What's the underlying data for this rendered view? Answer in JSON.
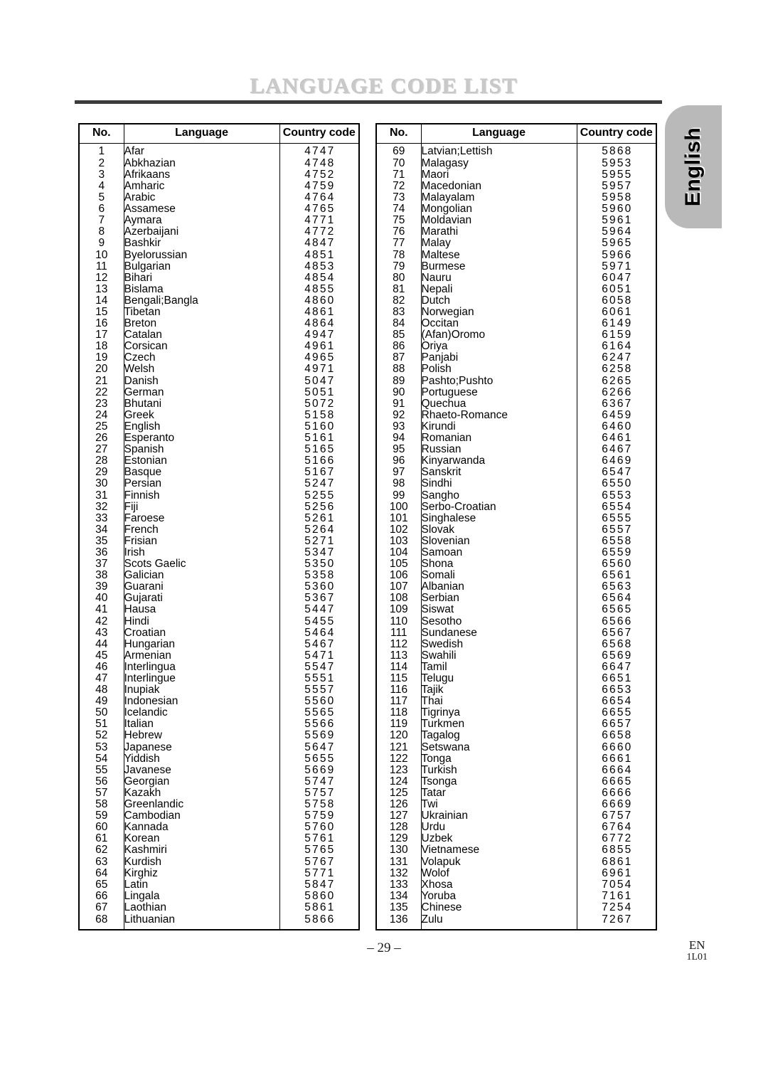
{
  "page": {
    "title": "LANGUAGE CODE LIST",
    "side_tab_label": "English",
    "footer_page_number": "– 29 –",
    "footer_region": "EN",
    "footer_doc_code": "1L01",
    "accent_rule_color": "#3b3b3b",
    "title_color": "#c9c9c9",
    "side_tab_color": "#b9b9b9"
  },
  "table": {
    "headers": {
      "no": "No.",
      "language": "Language",
      "country_code": "Country code"
    }
  },
  "chart_data": {
    "type": "table",
    "title": "LANGUAGE CODE LIST",
    "columns": [
      "No.",
      "Language",
      "Country code"
    ],
    "left_rows": [
      [
        "1",
        "Afar",
        "4747"
      ],
      [
        "2",
        "Abkhazian",
        "4748"
      ],
      [
        "3",
        "Afrikaans",
        "4752"
      ],
      [
        "4",
        "Amharic",
        "4759"
      ],
      [
        "5",
        "Arabic",
        "4764"
      ],
      [
        "6",
        "Assamese",
        "4765"
      ],
      [
        "7",
        "Aymara",
        "4771"
      ],
      [
        "8",
        "Azerbaijani",
        "4772"
      ],
      [
        "9",
        "Bashkir",
        "4847"
      ],
      [
        "10",
        "Byelorussian",
        "4851"
      ],
      [
        "11",
        "Bulgarian",
        "4853"
      ],
      [
        "12",
        "Bihari",
        "4854"
      ],
      [
        "13",
        "Bislama",
        "4855"
      ],
      [
        "14",
        "Bengali;Bangla",
        "4860"
      ],
      [
        "15",
        "Tibetan",
        "4861"
      ],
      [
        "16",
        "Breton",
        "4864"
      ],
      [
        "17",
        "Catalan",
        "4947"
      ],
      [
        "18",
        "Corsican",
        "4961"
      ],
      [
        "19",
        "Czech",
        "4965"
      ],
      [
        "20",
        "Welsh",
        "4971"
      ],
      [
        "21",
        "Danish",
        "5047"
      ],
      [
        "22",
        "German",
        "5051"
      ],
      [
        "23",
        "Bhutani",
        "5072"
      ],
      [
        "24",
        "Greek",
        "5158"
      ],
      [
        "25",
        "English",
        "5160"
      ],
      [
        "26",
        "Esperanto",
        "5161"
      ],
      [
        "27",
        "Spanish",
        "5165"
      ],
      [
        "28",
        "Estonian",
        "5166"
      ],
      [
        "29",
        "Basque",
        "5167"
      ],
      [
        "30",
        "Persian",
        "5247"
      ],
      [
        "31",
        "Finnish",
        "5255"
      ],
      [
        "32",
        "Fiji",
        "5256"
      ],
      [
        "33",
        "Faroese",
        "5261"
      ],
      [
        "34",
        "French",
        "5264"
      ],
      [
        "35",
        "Frisian",
        "5271"
      ],
      [
        "36",
        "Irish",
        "5347"
      ],
      [
        "37",
        "Scots Gaelic",
        "5350"
      ],
      [
        "38",
        "Galician",
        "5358"
      ],
      [
        "39",
        "Guarani",
        "5360"
      ],
      [
        "40",
        "Gujarati",
        "5367"
      ],
      [
        "41",
        "Hausa",
        "5447"
      ],
      [
        "42",
        "Hindi",
        "5455"
      ],
      [
        "43",
        "Croatian",
        "5464"
      ],
      [
        "44",
        "Hungarian",
        "5467"
      ],
      [
        "45",
        "Armenian",
        "5471"
      ],
      [
        "46",
        "Interlingua",
        "5547"
      ],
      [
        "47",
        "Interlingue",
        "5551"
      ],
      [
        "48",
        "Inupiak",
        "5557"
      ],
      [
        "49",
        "Indonesian",
        "5560"
      ],
      [
        "50",
        "Icelandic",
        "5565"
      ],
      [
        "51",
        "Italian",
        "5566"
      ],
      [
        "52",
        "Hebrew",
        "5569"
      ],
      [
        "53",
        "Japanese",
        "5647"
      ],
      [
        "54",
        "Yiddish",
        "5655"
      ],
      [
        "55",
        "Javanese",
        "5669"
      ],
      [
        "56",
        "Georgian",
        "5747"
      ],
      [
        "57",
        "Kazakh",
        "5757"
      ],
      [
        "58",
        "Greenlandic",
        "5758"
      ],
      [
        "59",
        "Cambodian",
        "5759"
      ],
      [
        "60",
        "Kannada",
        "5760"
      ],
      [
        "61",
        "Korean",
        "5761"
      ],
      [
        "62",
        "Kashmiri",
        "5765"
      ],
      [
        "63",
        "Kurdish",
        "5767"
      ],
      [
        "64",
        "Kirghiz",
        "5771"
      ],
      [
        "65",
        "Latin",
        "5847"
      ],
      [
        "66",
        "Lingala",
        "5860"
      ],
      [
        "67",
        "Laothian",
        "5861"
      ],
      [
        "68",
        "Lithuanian",
        "5866"
      ]
    ],
    "right_rows": [
      [
        "69",
        "Latvian;Lettish",
        "5868"
      ],
      [
        "70",
        "Malagasy",
        "5953"
      ],
      [
        "71",
        "Maori",
        "5955"
      ],
      [
        "72",
        "Macedonian",
        "5957"
      ],
      [
        "73",
        "Malayalam",
        "5958"
      ],
      [
        "74",
        "Mongolian",
        "5960"
      ],
      [
        "75",
        "Moldavian",
        "5961"
      ],
      [
        "76",
        "Marathi",
        "5964"
      ],
      [
        "77",
        "Malay",
        "5965"
      ],
      [
        "78",
        "Maltese",
        "5966"
      ],
      [
        "79",
        "Burmese",
        "5971"
      ],
      [
        "80",
        "Nauru",
        "6047"
      ],
      [
        "81",
        "Nepali",
        "6051"
      ],
      [
        "82",
        "Dutch",
        "6058"
      ],
      [
        "83",
        "Norwegian",
        "6061"
      ],
      [
        "84",
        "Occitan",
        "6149"
      ],
      [
        "85",
        "(Afan)Oromo",
        "6159"
      ],
      [
        "86",
        "Oriya",
        "6164"
      ],
      [
        "87",
        "Panjabi",
        "6247"
      ],
      [
        "88",
        "Polish",
        "6258"
      ],
      [
        "89",
        "Pashto;Pushto",
        "6265"
      ],
      [
        "90",
        "Portuguese",
        "6266"
      ],
      [
        "91",
        "Quechua",
        "6367"
      ],
      [
        "92",
        "Rhaeto-Romance",
        "6459"
      ],
      [
        "93",
        "Kirundi",
        "6460"
      ],
      [
        "94",
        "Romanian",
        "6461"
      ],
      [
        "95",
        "Russian",
        "6467"
      ],
      [
        "96",
        "Kinyarwanda",
        "6469"
      ],
      [
        "97",
        "Sanskrit",
        "6547"
      ],
      [
        "98",
        "Sindhi",
        "6550"
      ],
      [
        "99",
        "Sangho",
        "6553"
      ],
      [
        "100",
        "Serbo-Croatian",
        "6554"
      ],
      [
        "101",
        "Singhalese",
        "6555"
      ],
      [
        "102",
        "Slovak",
        "6557"
      ],
      [
        "103",
        "Slovenian",
        "6558"
      ],
      [
        "104",
        "Samoan",
        "6559"
      ],
      [
        "105",
        "Shona",
        "6560"
      ],
      [
        "106",
        "Somali",
        "6561"
      ],
      [
        "107",
        "Albanian",
        "6563"
      ],
      [
        "108",
        "Serbian",
        "6564"
      ],
      [
        "109",
        "Siswat",
        "6565"
      ],
      [
        "110",
        "Sesotho",
        "6566"
      ],
      [
        "111",
        "Sundanese",
        "6567"
      ],
      [
        "112",
        "Swedish",
        "6568"
      ],
      [
        "113",
        "Swahili",
        "6569"
      ],
      [
        "114",
        "Tamil",
        "6647"
      ],
      [
        "115",
        "Telugu",
        "6651"
      ],
      [
        "116",
        "Tajik",
        "6653"
      ],
      [
        "117",
        "Thai",
        "6654"
      ],
      [
        "118",
        "Tigrinya",
        "6655"
      ],
      [
        "119",
        "Turkmen",
        "6657"
      ],
      [
        "120",
        "Tagalog",
        "6658"
      ],
      [
        "121",
        "Setswana",
        "6660"
      ],
      [
        "122",
        "Tonga",
        "6661"
      ],
      [
        "123",
        "Turkish",
        "6664"
      ],
      [
        "124",
        "Tsonga",
        "6665"
      ],
      [
        "125",
        "Tatar",
        "6666"
      ],
      [
        "126",
        "Twi",
        "6669"
      ],
      [
        "127",
        "Ukrainian",
        "6757"
      ],
      [
        "128",
        "Urdu",
        "6764"
      ],
      [
        "129",
        "Uzbek",
        "6772"
      ],
      [
        "130",
        "Vietnamese",
        "6855"
      ],
      [
        "131",
        "Volapuk",
        "6861"
      ],
      [
        "132",
        "Wolof",
        "6961"
      ],
      [
        "133",
        "Xhosa",
        "7054"
      ],
      [
        "134",
        "Yoruba",
        "7161"
      ],
      [
        "135",
        "Chinese",
        "7254"
      ],
      [
        "136",
        "Zulu",
        "7267"
      ]
    ]
  }
}
